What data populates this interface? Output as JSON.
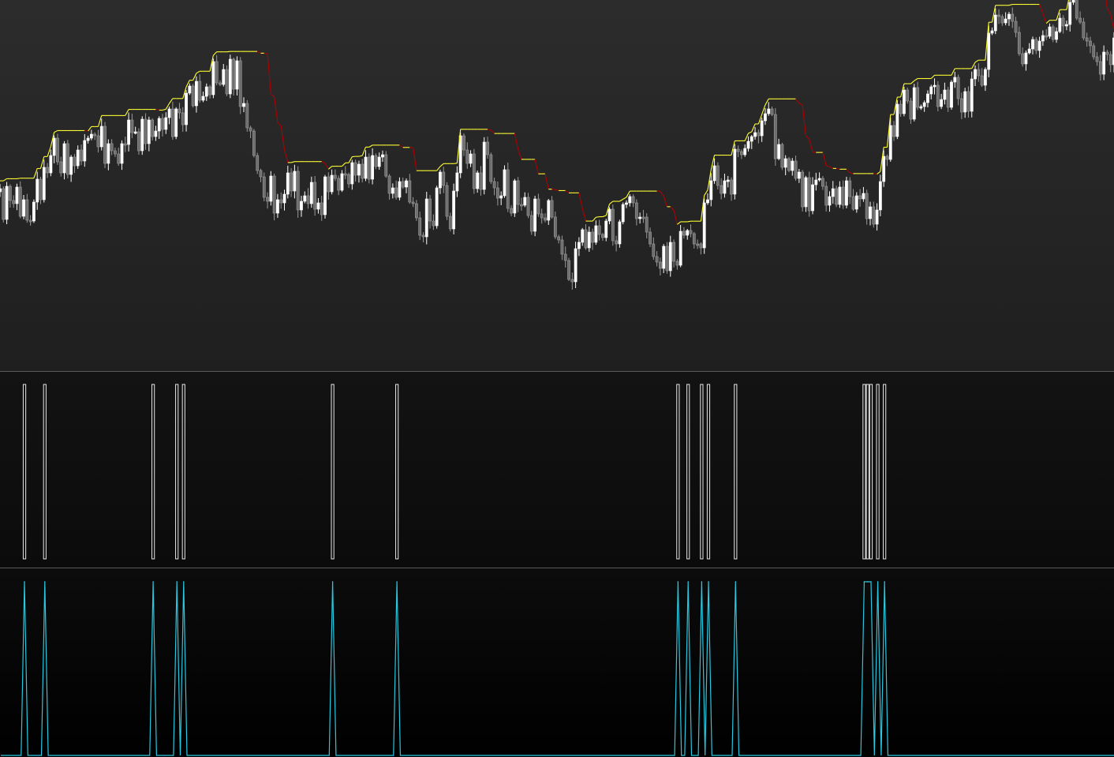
{
  "theme": {
    "up_candle": "#ffffff",
    "down_candle": "#9a9a9a",
    "stop_rising": "#ffff33",
    "stop_falling": "#b00000",
    "signal_bar": "#e8e8e8",
    "signal_line": "#28c8e0",
    "divider": "#5a5a5a"
  },
  "chart_data": [
    {
      "type": "candlestick",
      "title": "",
      "grid": false,
      "ylim": [
        0,
        470
      ],
      "series": [
        {
          "kind": "ohlc",
          "close": [
            227,
            266,
            224,
            242,
            246,
            225,
            262,
            241,
            267,
            268,
            244,
            215,
            241,
            200,
            207,
            185,
            163,
            193,
            207,
            170,
            209,
            187,
            198,
            178,
            192,
            166,
            163,
            158,
            160,
            174,
            148,
            195,
            170,
            179,
            183,
            195,
            170,
            171,
            140,
            156,
            155,
            179,
            139,
            170,
            140,
            161,
            154,
            138,
            152,
            137,
            126,
            161,
            126,
            131,
            146,
            106,
            97,
            122,
            91,
            115,
            110,
            98,
            108,
            66,
            93,
            95,
            76,
            107,
            63,
            101,
            65,
            123,
            119,
            150,
            154,
            185,
            204,
            212,
            238,
            243,
            211,
            258,
            241,
            245,
            234,
            207,
            230,
            205,
            254,
            243,
            236,
            246,
            219,
            253,
            245,
            260,
            212,
            231,
            210,
            214,
            229,
            208,
            209,
            221,
            194,
            210,
            196,
            214,
            187,
            215,
            185,
            199,
            187,
            184,
            211,
            233,
            226,
            238,
            218,
            225,
            217,
            244,
            246,
            264,
            286,
            288,
            240,
            268,
            274,
            226,
            206,
            223,
            262,
            278,
            230,
            207,
            160,
            178,
            195,
            183,
            227,
            207,
            228,
            168,
            184,
            218,
            226,
            239,
            236,
            203,
            252,
            258,
            217,
            247,
            248,
            238,
            261,
            281,
            240,
            259,
            264,
            267,
            242,
            263,
            288,
            292,
            310,
            318,
            342,
            345,
            303,
            295,
            279,
            302,
            282,
            295,
            274,
            285,
            289,
            268,
            253,
            293,
            297,
            269,
            247,
            245,
            237,
            245,
            265,
            263,
            263,
            282,
            297,
            313,
            320,
            328,
            300,
            331,
            295,
            319,
            324,
            281,
            286,
            280,
            284,
            297,
            297,
            302,
            245,
            241,
            217,
            198,
            223,
            233,
            217,
            216,
            234,
            177,
            180,
            184,
            176,
            167,
            161,
            156,
            160,
            141,
            132,
            126,
            133,
            189,
            171,
            200,
            189,
            204,
            192,
            214,
            206,
            250,
            213,
            255,
            222,
            216,
            214,
            224,
            248,
            237,
            227,
            247,
            225,
            248,
            217,
            237,
            253,
            236,
            240,
            233,
            265,
            250,
            272,
            254,
            218,
            186,
            190,
            147,
            161,
            120,
            132,
            102,
            116,
            139,
            99,
            124,
            123,
            118,
            107,
            98,
            96,
            123,
            114,
            102,
            124,
            92,
            86,
            113,
            130,
            104,
            129,
            88,
            76,
            84,
            96,
            76,
            30,
            27,
            7,
            9,
            17,
            12,
            6,
            15,
            29,
            56,
            69,
            55,
            50,
            38,
            52,
            40,
            33,
            34,
            22,
            38,
            28,
            11,
            21,
            19,
            -9,
            -18,
            11,
            16,
            36,
            40,
            46,
            60,
            66,
            82,
            54,
            57,
            70,
            36
          ]
        }
      ]
    },
    {
      "type": "bar",
      "title": "",
      "categories": [
        7,
        13,
        45,
        52,
        54,
        98,
        117,
        200,
        203,
        207,
        209,
        217,
        255,
        256,
        257,
        259,
        261
      ],
      "values": [
        1,
        1,
        1,
        1,
        1,
        1,
        1,
        1,
        1,
        1,
        1,
        1,
        1,
        1,
        1,
        1,
        1
      ],
      "ylim": [
        0,
        1
      ],
      "grid": false
    },
    {
      "type": "line",
      "title": "",
      "x_marks": [
        7,
        13,
        45,
        52,
        54,
        98,
        117,
        200,
        203,
        207,
        209,
        217,
        255,
        256,
        257,
        259,
        261
      ],
      "ylim": [
        0,
        1
      ],
      "grid": false
    }
  ]
}
